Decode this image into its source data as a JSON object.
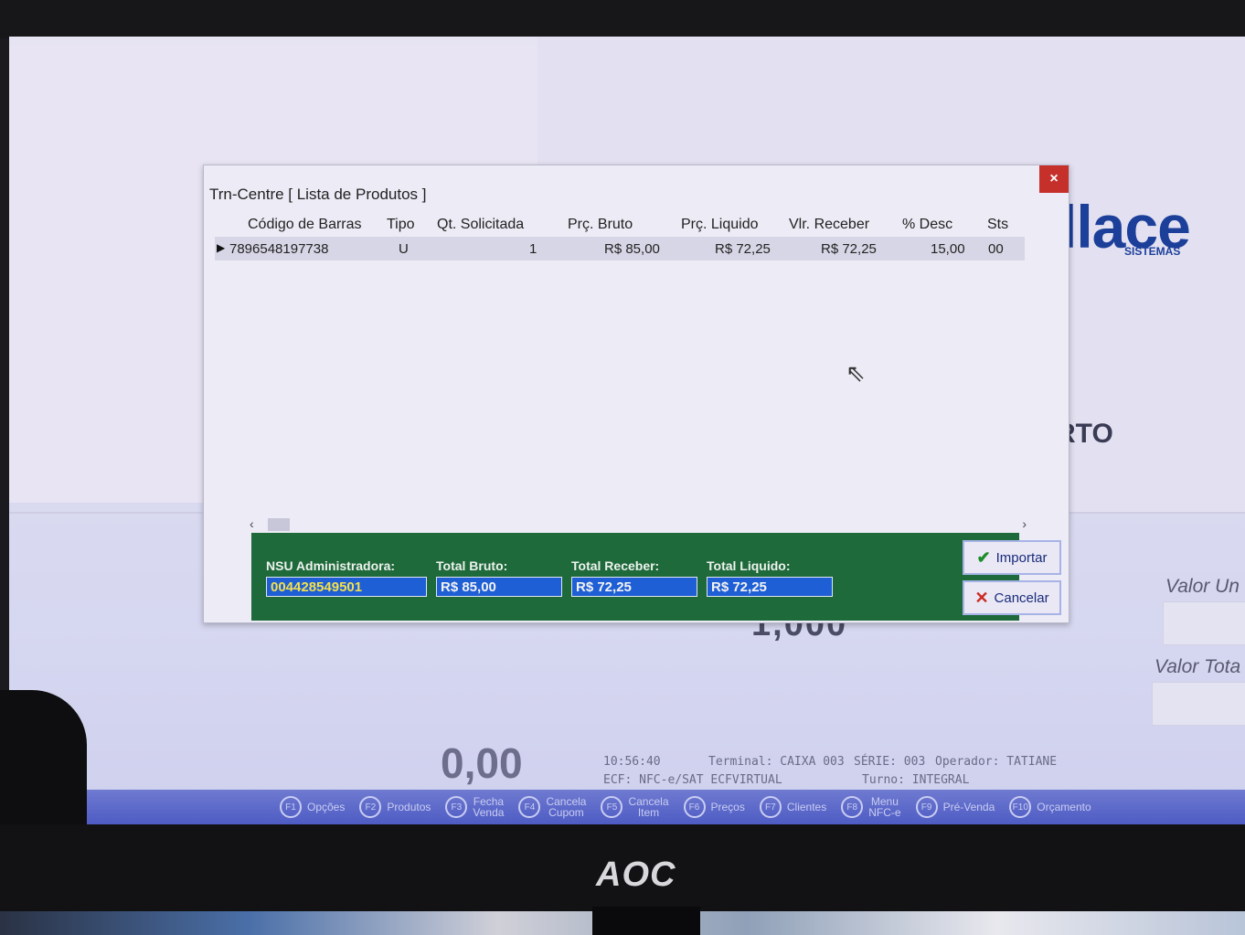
{
  "dialog": {
    "title": "Trn-Centre [ Lista de Produtos ]",
    "close_label": "×",
    "columns": [
      "Código de Barras",
      "Tipo",
      "Qt. Solicitada",
      "Prç. Bruto",
      "Prç. Liquido",
      "Vlr. Receber",
      "% Desc",
      "Sts"
    ],
    "rows": [
      {
        "barcode": "7896548197738",
        "tipo": "U",
        "qt": "1",
        "preco_bruto": "R$ 85,00",
        "preco_liquido": "R$ 72,25",
        "valor_receber": "R$ 72,25",
        "desc": "15,00",
        "sts": "00"
      }
    ],
    "scroll_left": "‹",
    "scroll_right": "›",
    "footer": {
      "nsu_label": "NSU Administradora:",
      "nsu_value": "004428549501",
      "total_bruto_label": "Total Bruto:",
      "total_bruto_value": "R$ 85,00",
      "total_receber_label": "Total Receber:",
      "total_receber_value": "R$ 72,25",
      "total_liquido_label": "Total Liquido:",
      "total_liquido_value": "R$ 72,25",
      "import_label": "Importar",
      "cancel_label": "Cancelar"
    }
  },
  "background": {
    "logo_text": "llace",
    "logo_sub": "SISTEMAS",
    "status_word": "ERTO",
    "quantity": "1,000",
    "valor_unitario_label": "Valor Un",
    "valor_total_label": "Valor Tota",
    "total_display": "0,00",
    "time": "10:56:40",
    "terminal": "Terminal: CAIXA 003",
    "serie": "SÉRIE: 003",
    "operador": "Operador: TATIANE",
    "ecf": "ECF: NFC-e/SAT ECFVIRTUAL",
    "turno": "Turno: INTEGRAL"
  },
  "function_keys": [
    {
      "key": "F1",
      "label": "Opções"
    },
    {
      "key": "F2",
      "label": "Produtos"
    },
    {
      "key": "F3",
      "label": "Fecha",
      "label2": "Venda"
    },
    {
      "key": "F4",
      "label": "Cancela",
      "label2": "Cupom"
    },
    {
      "key": "F5",
      "label": "Cancela",
      "label2": "Item"
    },
    {
      "key": "F6",
      "label": "Preços"
    },
    {
      "key": "F7",
      "label": "Clientes"
    },
    {
      "key": "F8",
      "label": "Menu",
      "label2": "NFC-e"
    },
    {
      "key": "F9",
      "label": "Pré-Venda"
    },
    {
      "key": "F10",
      "label": "Orçamento"
    }
  ],
  "monitor_brand": "AOC",
  "colors": {
    "footer_green": "#1e6a3a",
    "field_blue": "#1f5fd6",
    "nsu_yellow": "#f4e04a",
    "close_red": "#c5302a",
    "fbar_blue": "#4e5cc4",
    "logo_blue": "#1c3f9a"
  }
}
